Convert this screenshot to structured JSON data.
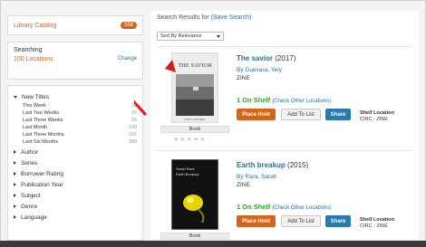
{
  "sidebar": {
    "catalog": {
      "label": "Library Catalog",
      "count": "558"
    },
    "searching": {
      "title": "Searching",
      "locations": "100 Locations",
      "change": "Change"
    },
    "facets": [
      {
        "label": "New Titles",
        "expanded": true,
        "items": [
          {
            "label": "This Week",
            "count": "18"
          },
          {
            "label": "Last Two Weeks",
            "count": "25"
          },
          {
            "label": "Last Three Weeks",
            "count": "29"
          },
          {
            "label": "Last Month",
            "count": "108"
          },
          {
            "label": "Last Three Months",
            "count": "155"
          },
          {
            "label": "Last Six Months",
            "count": "388"
          }
        ]
      },
      {
        "label": "Author",
        "expanded": false
      },
      {
        "label": "Series",
        "expanded": false
      },
      {
        "label": "Borrower Rating",
        "expanded": false
      },
      {
        "label": "Publication Year",
        "expanded": false
      },
      {
        "label": "Subject",
        "expanded": false
      },
      {
        "label": "Genre",
        "expanded": false
      },
      {
        "label": "Language",
        "expanded": false
      }
    ]
  },
  "main": {
    "heading": "Search Results for",
    "save_search": "(Save Search)",
    "sort": {
      "selected": "Sort By Relevance"
    },
    "results": [
      {
        "title": "The savior",
        "year": "(2017)",
        "author": "By Guevara, Yeiy",
        "format": "ZINE",
        "cover_title": "THE SAVIOR",
        "cover_author": "YEIY GUEVARA",
        "format_label": "Book",
        "status": "1 On Shelf",
        "check_other": "(Check Other Locations)",
        "buttons": {
          "hold": "Place Hold",
          "list": "Add To List",
          "share": "Share"
        },
        "shelf": {
          "label": "Shelf Location",
          "value": "CIRC - ZINE"
        }
      },
      {
        "title": "Earth breakup",
        "year": "(2015)",
        "author": "By Rara, Sarah",
        "format": "ZINE",
        "cover_title": "Earth Breakup",
        "cover_author": "Sarah Rara",
        "format_label": "Book",
        "status": "1 On Shelf",
        "check_other": "(Check Other Locations)",
        "buttons": {
          "hold": "Place Hold",
          "list": "Add To List",
          "share": "Share"
        },
        "shelf": {
          "label": "Shelf Location",
          "value": "CIRC - ZINE"
        }
      }
    ]
  },
  "colors": {
    "accent": "#d4651a",
    "link": "#2a6fa6",
    "on_shelf": "#3c9a33",
    "share": "#2a7ab0",
    "arrow": "#e01818"
  },
  "icons": {
    "rating": "star-icon",
    "expand": "caret-icon",
    "annotation": "arrow-icon"
  }
}
